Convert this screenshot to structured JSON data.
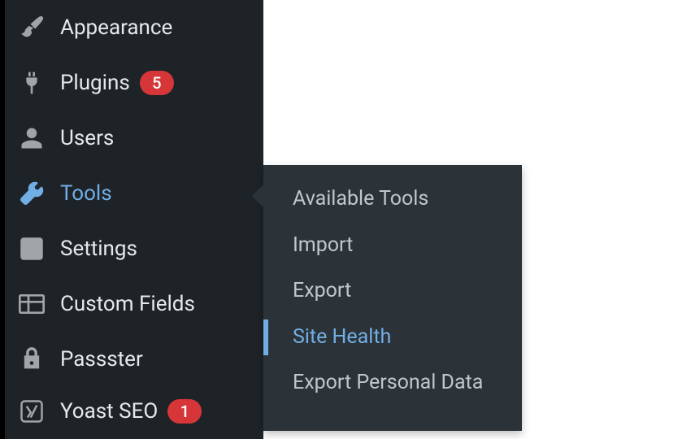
{
  "sidebar": {
    "items": [
      {
        "label": "Appearance"
      },
      {
        "label": "Plugins",
        "badge": "5"
      },
      {
        "label": "Users"
      },
      {
        "label": "Tools"
      },
      {
        "label": "Settings"
      },
      {
        "label": "Custom Fields"
      },
      {
        "label": "Passster"
      },
      {
        "label": "Yoast SEO",
        "badge": "1"
      }
    ]
  },
  "submenu": {
    "items": [
      {
        "label": "Available Tools"
      },
      {
        "label": "Import"
      },
      {
        "label": "Export"
      },
      {
        "label": "Site Health"
      },
      {
        "label": "Export Personal Data"
      }
    ]
  }
}
